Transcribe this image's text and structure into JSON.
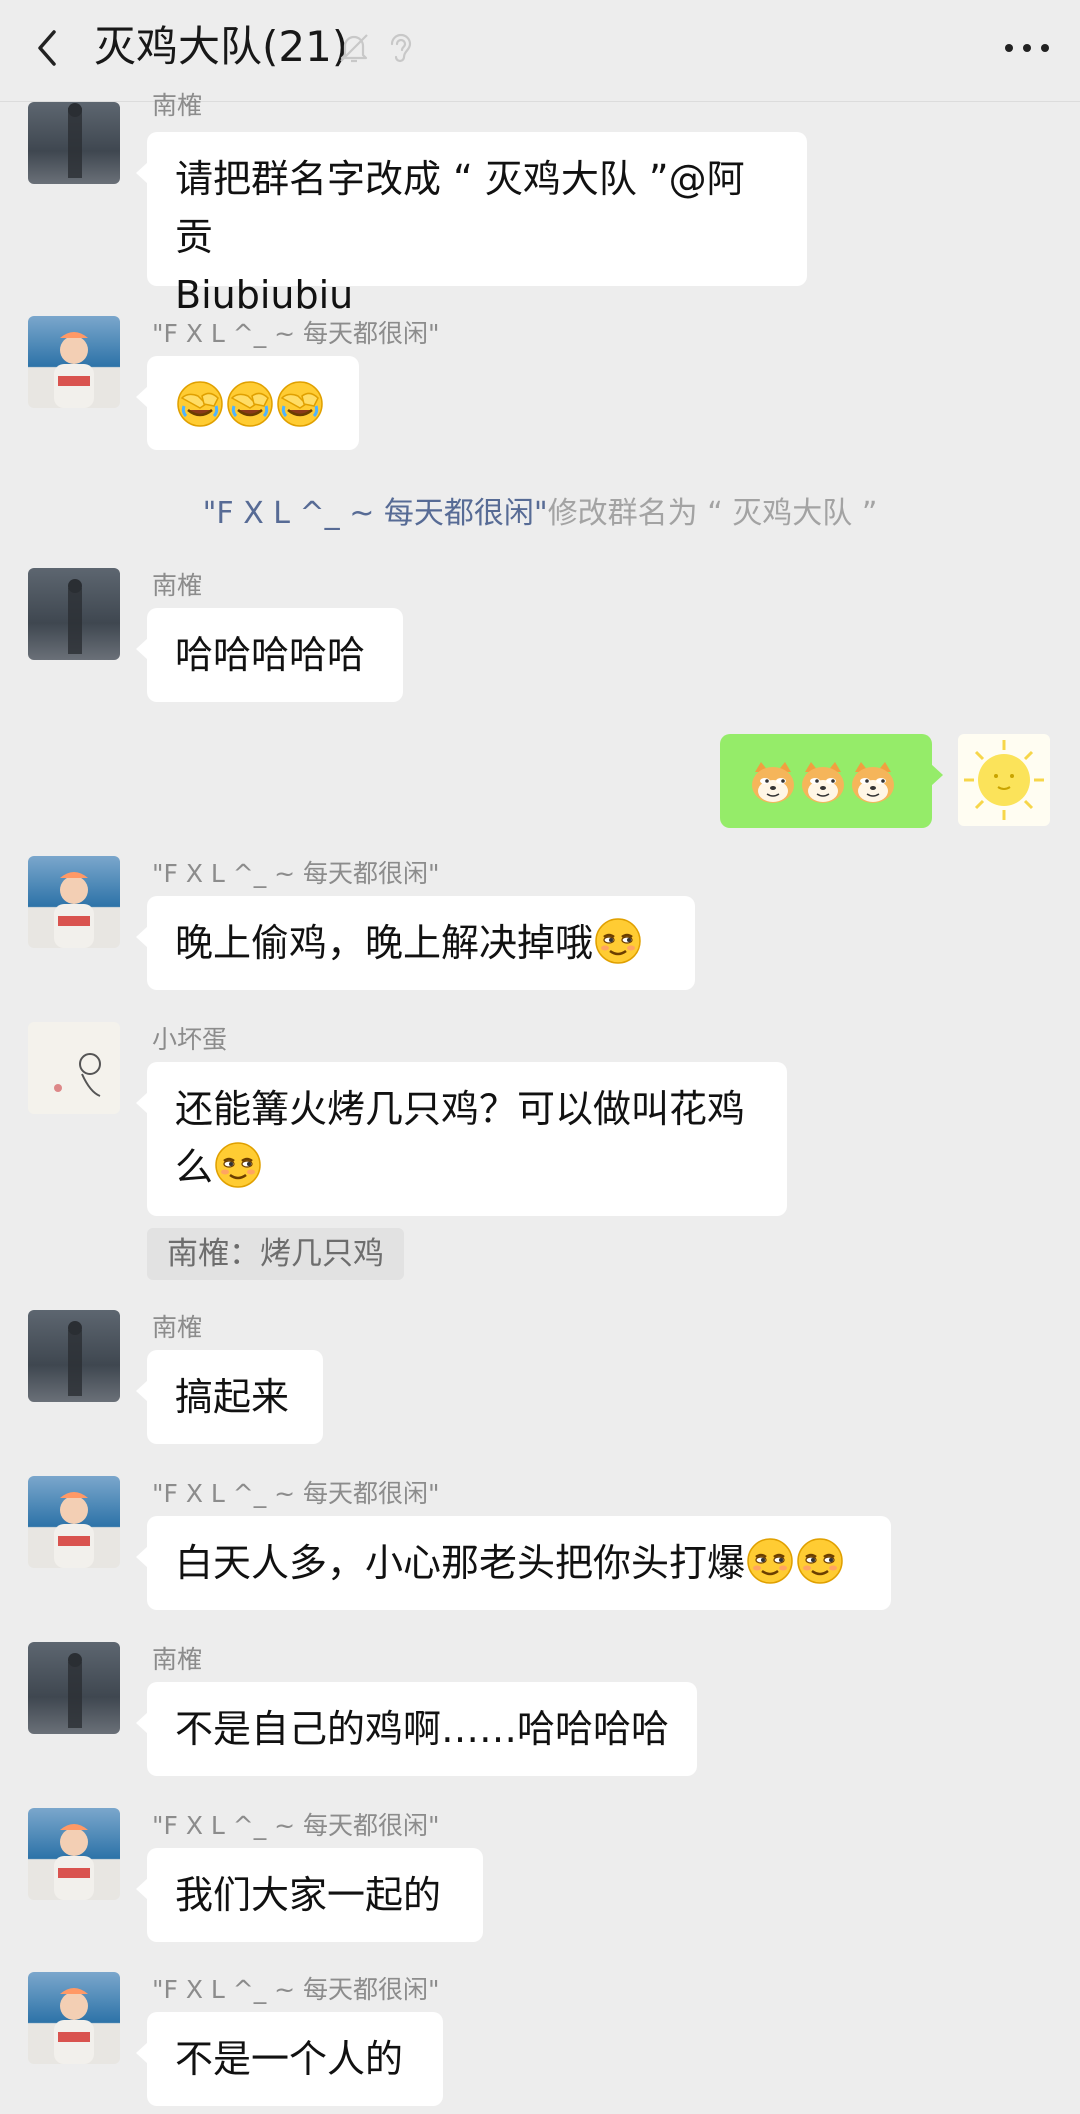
{
  "header": {
    "title": "灭鸡大队(21)",
    "back_icon": "chevron-left-icon",
    "mute_icon": "bell-off-icon",
    "ear_icon": "ear-icon",
    "more_icon": "more-horizontal-icon"
  },
  "colors": {
    "background": "#ededed",
    "bubble_incoming": "#ffffff",
    "bubble_outgoing": "#95ec69",
    "system_name": "#576b95",
    "sender_name": "#8c8c8c"
  },
  "messages": [
    {
      "sender": "南榷",
      "text": "请把群名字改成 “ 灭鸡大队 ”@阿贡",
      "text2": "Biubiubiu"
    },
    {
      "sender": "\"F X L ^_ ~ 每天都很闲\"",
      "emoji": "face-palm-emoji x3"
    },
    {
      "system_name": "\"F X L ^_ ~ 每天都很闲\"",
      "system_text": "修改群名为 “ 灭鸡大队 ”"
    },
    {
      "sender": "南榷",
      "text": "哈哈哈哈哈"
    },
    {
      "self": true,
      "emoji": "doge-emoji x3"
    },
    {
      "sender": "\"F X L ^_ ~ 每天都很闲\"",
      "text": "晚上偷鸡，晚上解决掉哦"
    },
    {
      "sender": "小坏蛋",
      "text": "还能篝火烤几只鸡？可以做叫花鸡",
      "text2": "么",
      "quote": "南榷：烤几只鸡"
    },
    {
      "sender": "南榷",
      "text": "搞起来"
    },
    {
      "sender": "\"F X L ^_ ~ 每天都很闲\"",
      "text": "白天人多，小心那老头把你头打爆"
    },
    {
      "sender": "南榷",
      "text": "不是自己的鸡啊……哈哈哈哈"
    },
    {
      "sender": "\"F X L ^_ ~ 每天都很闲\"",
      "text": "我们大家一起的"
    },
    {
      "sender": "\"F X L ^_ ~ 每天都很闲\"",
      "text": "不是一个人的"
    }
  ]
}
